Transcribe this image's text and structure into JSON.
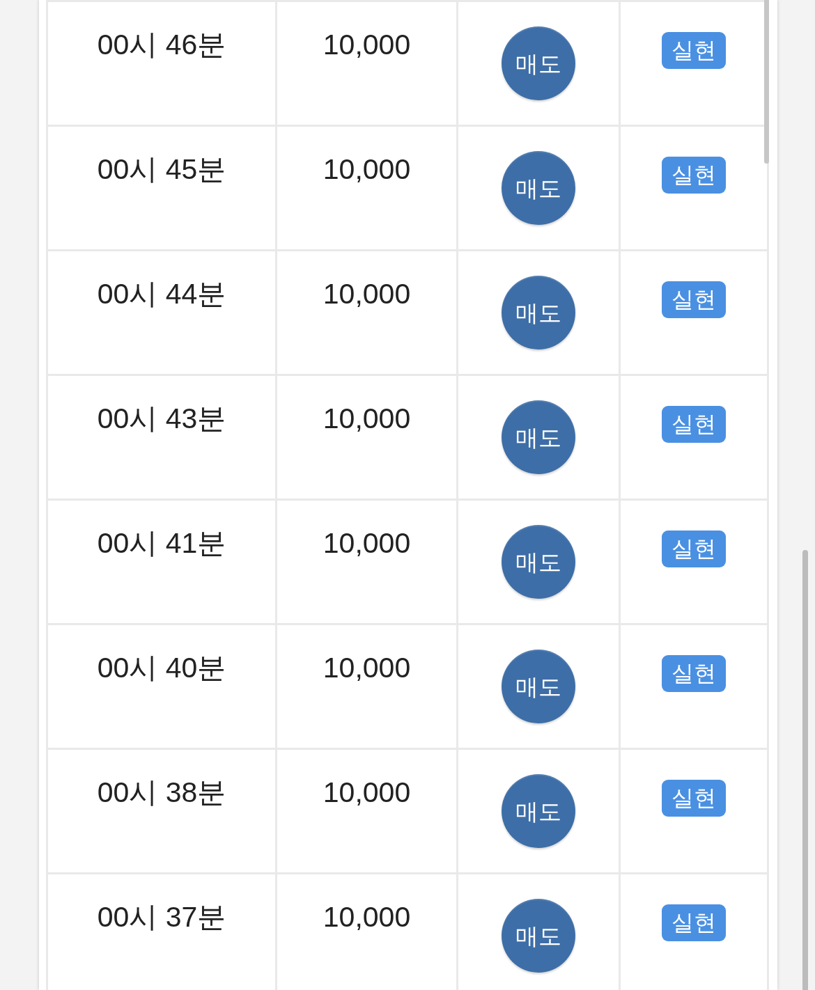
{
  "rows": [
    {
      "time": "00시 46분",
      "amount": "10,000",
      "action": "매도",
      "status": "실현"
    },
    {
      "time": "00시 45분",
      "amount": "10,000",
      "action": "매도",
      "status": "실현"
    },
    {
      "time": "00시 44분",
      "amount": "10,000",
      "action": "매도",
      "status": "실현"
    },
    {
      "time": "00시 43분",
      "amount": "10,000",
      "action": "매도",
      "status": "실현"
    },
    {
      "time": "00시 41분",
      "amount": "10,000",
      "action": "매도",
      "status": "실현"
    },
    {
      "time": "00시 40분",
      "amount": "10,000",
      "action": "매도",
      "status": "실현"
    },
    {
      "time": "00시 38분",
      "amount": "10,000",
      "action": "매도",
      "status": "실현"
    },
    {
      "time": "00시 37분",
      "amount": "10,000",
      "action": "매도",
      "status": "실현"
    }
  ]
}
